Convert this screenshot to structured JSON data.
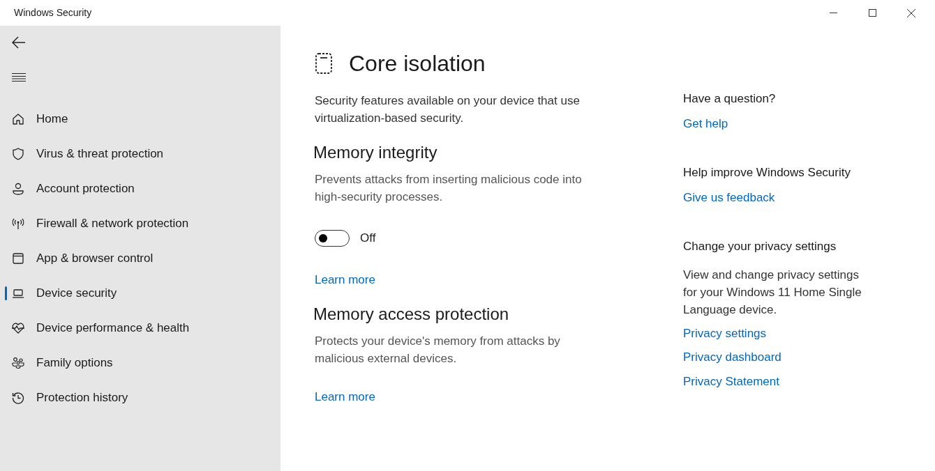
{
  "window": {
    "title": "Windows Security"
  },
  "sidebar": {
    "items": [
      {
        "label": "Home",
        "kind": "home",
        "selected": false
      },
      {
        "label": "Virus & threat protection",
        "kind": "shield",
        "selected": false
      },
      {
        "label": "Account protection",
        "kind": "person",
        "selected": false
      },
      {
        "label": "Firewall & network protection",
        "kind": "antenna",
        "selected": false
      },
      {
        "label": "App & browser control",
        "kind": "window",
        "selected": false
      },
      {
        "label": "Device security",
        "kind": "laptop",
        "selected": true
      },
      {
        "label": "Device performance & health",
        "kind": "heart",
        "selected": false
      },
      {
        "label": "Family options",
        "kind": "family",
        "selected": false
      },
      {
        "label": "Protection history",
        "kind": "history",
        "selected": false
      }
    ]
  },
  "page": {
    "title": "Core isolation",
    "description": "Security features available on your device that use virtualization-based security.",
    "sections": [
      {
        "heading": "Memory integrity",
        "description": "Prevents attacks from inserting malicious code into high-security processes.",
        "toggle": {
          "on": false,
          "label": "Off"
        },
        "link": "Learn more"
      },
      {
        "heading": "Memory access protection",
        "description": "Protects your device's memory from attacks by malicious external devices.",
        "link": "Learn more"
      }
    ]
  },
  "help": [
    {
      "heading": "Have a question?",
      "links": [
        "Get help"
      ]
    },
    {
      "heading": "Help improve Windows Security",
      "links": [
        "Give us feedback"
      ]
    },
    {
      "heading": "Change your privacy settings",
      "text": "View and change privacy settings for your Windows 11 Home Single Language device.",
      "links": [
        "Privacy settings",
        "Privacy dashboard",
        "Privacy Statement"
      ]
    }
  ]
}
